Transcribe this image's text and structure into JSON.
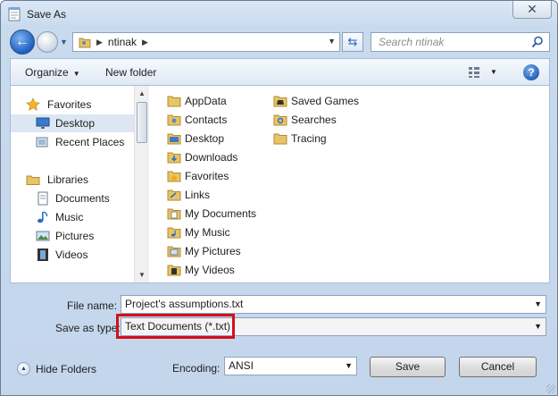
{
  "window": {
    "title": "Save As",
    "close_glyph": "✕"
  },
  "address": {
    "crumbs": [
      "ntinak"
    ],
    "folder_icon": "user-folder-icon"
  },
  "search": {
    "placeholder": "Search ntinak"
  },
  "toolbar": {
    "organize_label": "Organize",
    "new_folder_label": "New folder",
    "help_glyph": "?"
  },
  "sidebar": {
    "items": [
      {
        "label": "Favorites",
        "icon": "star-icon"
      },
      {
        "label": "Desktop",
        "icon": "desktop-icon",
        "selected": true
      },
      {
        "label": "Recent Places",
        "icon": "recent-places-icon"
      },
      {
        "label": "Libraries",
        "icon": "libraries-icon"
      },
      {
        "label": "Documents",
        "icon": "documents-icon"
      },
      {
        "label": "Music",
        "icon": "music-icon"
      },
      {
        "label": "Pictures",
        "icon": "pictures-icon"
      },
      {
        "label": "Videos",
        "icon": "videos-icon"
      }
    ]
  },
  "files": [
    {
      "name": "AppData",
      "icon": "folder-icon"
    },
    {
      "name": "Contacts",
      "icon": "contacts-folder-icon"
    },
    {
      "name": "Desktop",
      "icon": "desktop-folder-icon"
    },
    {
      "name": "Downloads",
      "icon": "downloads-folder-icon"
    },
    {
      "name": "Favorites",
      "icon": "favorites-folder-icon"
    },
    {
      "name": "Links",
      "icon": "links-folder-icon"
    },
    {
      "name": "My Documents",
      "icon": "documents-folder-icon"
    },
    {
      "name": "My Music",
      "icon": "music-folder-icon"
    },
    {
      "name": "My Pictures",
      "icon": "pictures-folder-icon"
    },
    {
      "name": "My Videos",
      "icon": "videos-folder-icon"
    },
    {
      "name": "Saved Games",
      "icon": "saved-games-folder-icon"
    },
    {
      "name": "Searches",
      "icon": "searches-folder-icon"
    },
    {
      "name": "Tracing",
      "icon": "folder-icon"
    }
  ],
  "form": {
    "file_name_label": "File name:",
    "file_name_value": "Project's assumptions.txt",
    "save_type_label": "Save as type:",
    "save_type_value": "Text Documents (*.txt)",
    "encoding_label": "Encoding:",
    "encoding_value": "ANSI"
  },
  "footer": {
    "hide_folders_label": "Hide Folders",
    "save_label": "Save",
    "cancel_label": "Cancel"
  },
  "colors": {
    "highlight": "#d4101b",
    "accent": "#1c5fbf",
    "folder": "#e8c467"
  }
}
